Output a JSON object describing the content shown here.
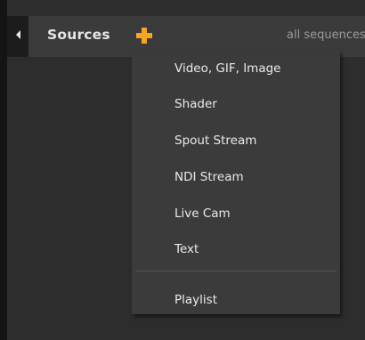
{
  "header": {
    "title": "Sources",
    "add_icon": "plus-icon",
    "sequence_label": "all sequences"
  },
  "menu": {
    "items": [
      {
        "label": "Video, GIF, Image"
      },
      {
        "label": "Shader"
      },
      {
        "label": "Spout Stream"
      },
      {
        "label": "NDI Stream"
      },
      {
        "label": "Live Cam"
      },
      {
        "label": "Text"
      }
    ],
    "playlist_label": "Playlist"
  },
  "colors": {
    "accent": "#f5a623",
    "panel_bg": "#2d2d2d",
    "header_bg": "#3b3b3b",
    "menu_bg": "#3b3b3b",
    "text": "#eaeaea",
    "muted_text": "#9a9a9a"
  }
}
